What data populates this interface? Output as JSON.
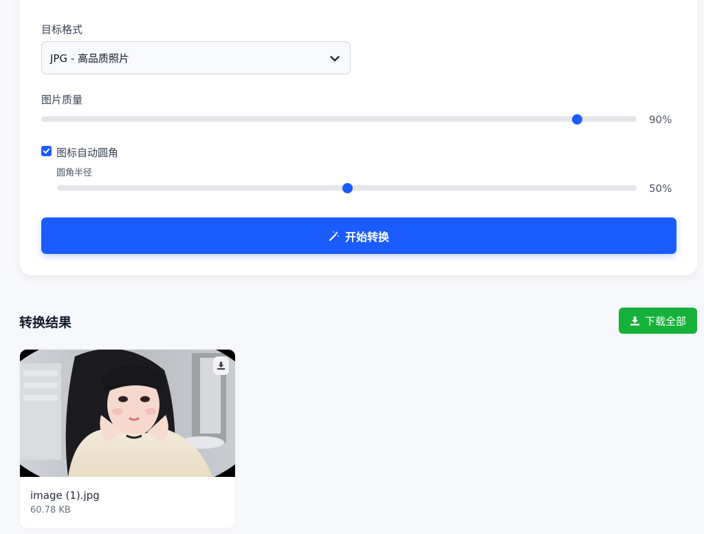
{
  "settings": {
    "format_label": "目标格式",
    "format_selected": "JPG - 高品质照片",
    "quality_label": "图片质量",
    "quality_value": 90,
    "quality_text": "90%",
    "rounded_corners_label": "图标自动圆角",
    "rounded_corners_checked": true,
    "radius_label": "圆角半径",
    "radius_value": 50,
    "radius_text": "50%",
    "convert_button_label": "开始转换"
  },
  "results": {
    "title": "转换结果",
    "download_all_label": "下载全部",
    "items": [
      {
        "file_name": "image (1).jpg",
        "file_size": "60.78 KB"
      }
    ]
  },
  "colors": {
    "primary": "#1a5cff",
    "success": "#16b13a",
    "track": "#e4e6ea"
  }
}
